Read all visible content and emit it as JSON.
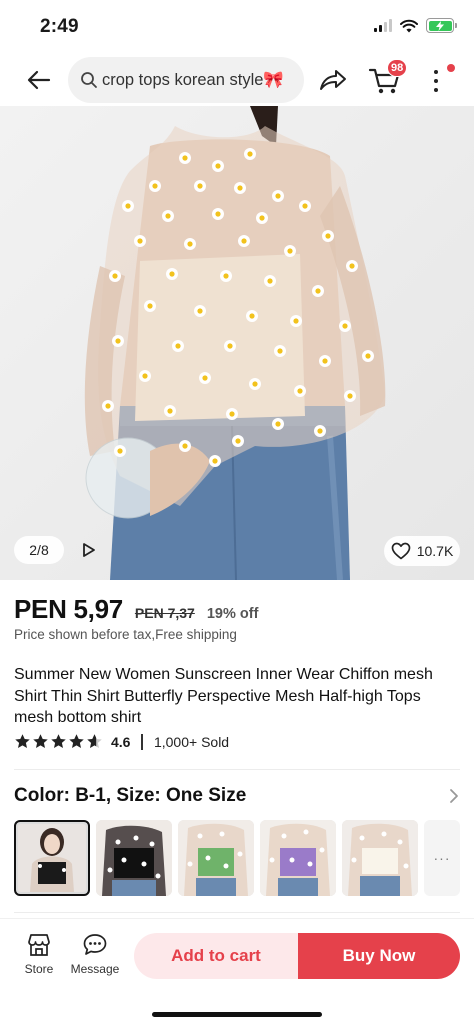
{
  "status_bar": {
    "time": "2:49",
    "battery_charging": true,
    "battery_color": "#35c759"
  },
  "top_nav": {
    "search_value": "crop tops korean style🎀",
    "cart_badge": "98",
    "accent_color": "#e5414b",
    "icons": [
      "back-arrow-icon",
      "search-icon",
      "share-icon",
      "cart-icon",
      "more-vertical-icon"
    ]
  },
  "gallery": {
    "counter": "2/8",
    "likes": "10.7K",
    "icons": [
      "play-icon",
      "heart-icon"
    ]
  },
  "product": {
    "price": "PEN 5,97",
    "old_price": "PEN 7,37",
    "discount": "19% off",
    "price_note": "Price shown before tax,Free shipping",
    "title": "Summer New Women Sunscreen Inner Wear Chiffon mesh Shirt Thin Shirt Butterfly Perspective Mesh Half-high Tops mesh bottom shirt",
    "rating": "4.6",
    "rating_stars": 4.6,
    "sold": "1,000+ Sold"
  },
  "variant": {
    "heading": "Color: B-1, Size: One Size",
    "more_label": "···",
    "thumbnails": [
      {
        "name": "B-1",
        "selected": true
      },
      {
        "name": "variant-2",
        "selected": false
      },
      {
        "name": "variant-3",
        "selected": false
      },
      {
        "name": "variant-4",
        "selected": false
      },
      {
        "name": "variant-5",
        "selected": false
      }
    ]
  },
  "bottom_bar": {
    "store_label": "Store",
    "message_label": "Message",
    "add_to_cart": "Add to cart",
    "buy_now": "Buy Now"
  }
}
